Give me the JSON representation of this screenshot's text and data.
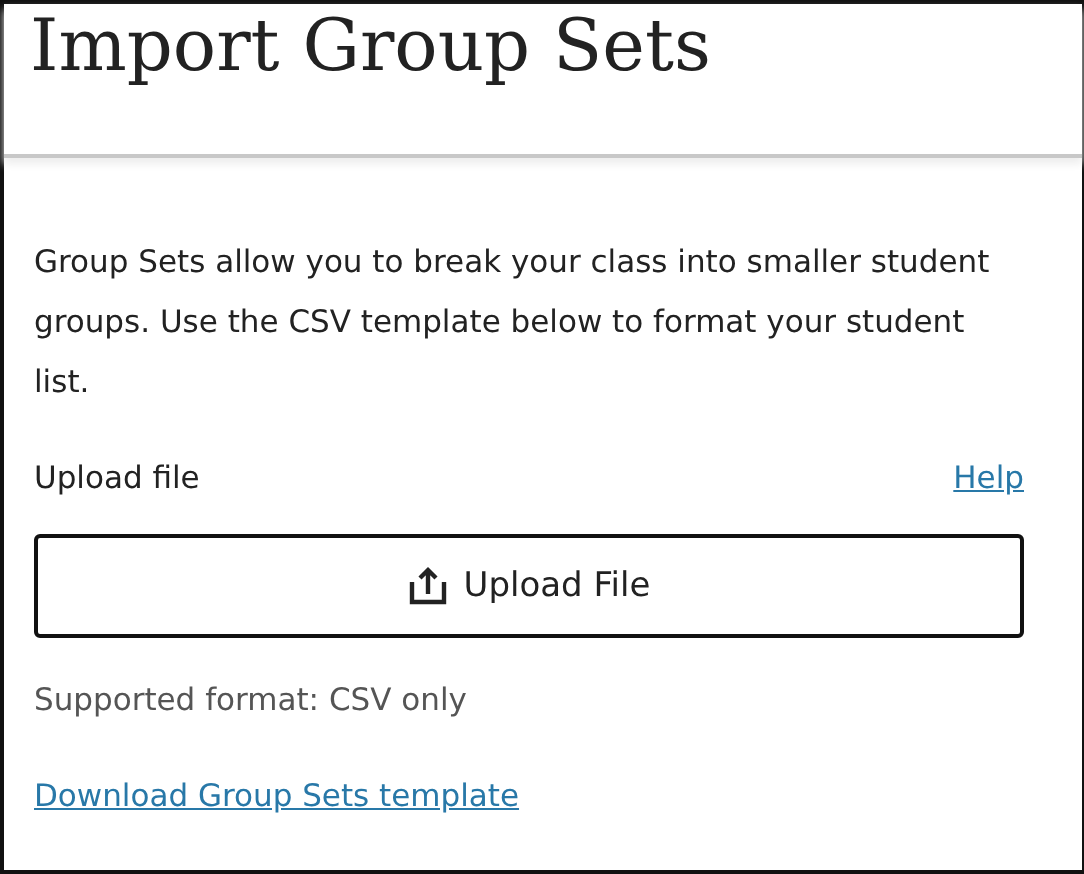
{
  "title": "Import Group Sets",
  "description": "Group Sets allow you to break your class into smaller student groups. Use the CSV template below to format your student list.",
  "upload": {
    "label": "Upload file",
    "help_link": "Help",
    "button": "Upload File",
    "format_note": "Supported format: CSV only"
  },
  "template_link": "Download Group Sets template"
}
